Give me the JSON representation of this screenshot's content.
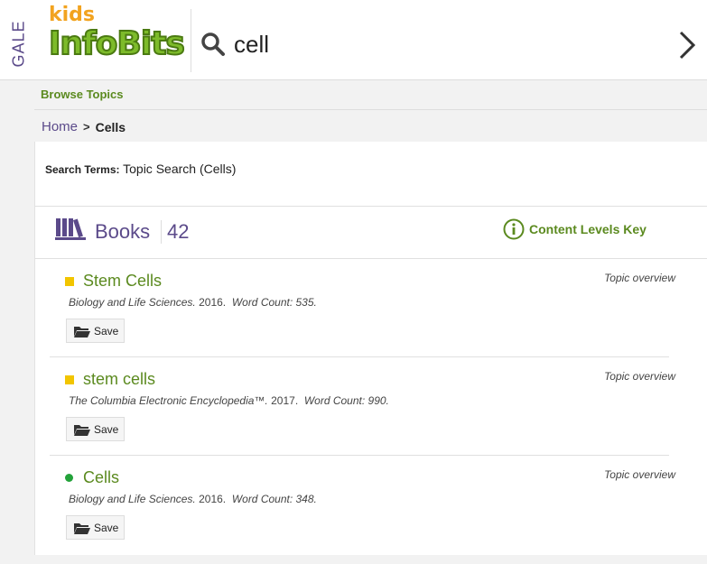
{
  "header": {
    "gale": "GALE",
    "logo_kids": "kids",
    "logo_main": "InfoBits",
    "search_value": "cell"
  },
  "nav": {
    "browse_topics": "Browse Topics"
  },
  "breadcrumb": {
    "home": "Home",
    "current": "Cells"
  },
  "search_terms": {
    "label": "Search Terms:",
    "value": "Topic Search (Cells)"
  },
  "section": {
    "label": "Books",
    "count": "42",
    "key_label": "Content Levels Key"
  },
  "results": [
    {
      "title": "Stem Cells",
      "level": "square-yellow",
      "type": "Topic overview",
      "source": "Biology and Life Sciences.",
      "year": "2016.",
      "word_count": "Word Count: 535.",
      "save": "Save"
    },
    {
      "title": "stem cells",
      "level": "square-yellow",
      "type": "Topic overview",
      "source": "The Columbia Electronic Encyclopedia™.",
      "year": "2017.",
      "word_count": "Word Count: 990.",
      "save": "Save"
    },
    {
      "title": "Cells",
      "level": "circle-green",
      "type": "Topic overview",
      "source": "Biology and Life Sciences.",
      "year": "2016.",
      "word_count": "Word Count: 348.",
      "save": "Save"
    }
  ],
  "colors": {
    "brand_purple": "#5b4a8a",
    "brand_green": "#5b8a1f",
    "level_yellow": "#f2c500",
    "level_green": "#23a23a"
  }
}
